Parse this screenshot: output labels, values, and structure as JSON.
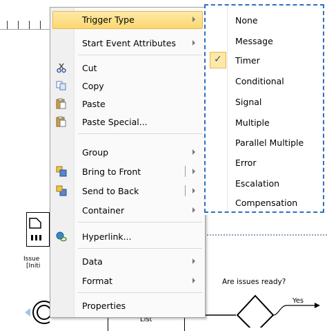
{
  "menu": {
    "items": [
      {
        "label": "Trigger Type",
        "icon": "",
        "submenu": true
      },
      {
        "label": "Start Event Attributes",
        "icon": "",
        "submenu": true
      },
      {
        "label": "Cut",
        "icon": "scissors-icon",
        "submenu": false
      },
      {
        "label": "Copy",
        "icon": "copy-icon",
        "submenu": false
      },
      {
        "label": "Paste",
        "icon": "paste-icon",
        "submenu": false
      },
      {
        "label": "Paste Special...",
        "icon": "paste-special-icon",
        "submenu": false
      },
      {
        "label": "Group",
        "icon": "",
        "submenu": true
      },
      {
        "label": "Bring to Front",
        "icon": "bring-to-front-icon",
        "submenu": true
      },
      {
        "label": "Send to Back",
        "icon": "send-to-back-icon",
        "submenu": true
      },
      {
        "label": "Container",
        "icon": "",
        "submenu": true
      },
      {
        "label": "Hyperlink...",
        "icon": "hyperlink-icon",
        "submenu": false
      },
      {
        "label": "Data",
        "icon": "",
        "submenu": true
      },
      {
        "label": "Format",
        "icon": "",
        "submenu": true
      },
      {
        "label": "Properties",
        "icon": "",
        "submenu": false
      }
    ]
  },
  "submenu": {
    "items": [
      {
        "label": "None"
      },
      {
        "label": "Message"
      },
      {
        "label": "Timer",
        "checked": true
      },
      {
        "label": "Conditional"
      },
      {
        "label": "Signal"
      },
      {
        "label": "Multiple"
      },
      {
        "label": "Parallel Multiple"
      },
      {
        "label": "Error"
      },
      {
        "label": "Escalation"
      },
      {
        "label": "Compensation"
      }
    ],
    "check_glyph": "✓"
  },
  "diagram": {
    "issue_label_1": "Issue",
    "issue_label_2": "[Initi",
    "decision_label": "Are issues ready?",
    "yes_label": "Yes",
    "list_label": "List"
  },
  "colors": {
    "highlight": "#fbd76f",
    "submenu_border": "#2e6fbf"
  }
}
